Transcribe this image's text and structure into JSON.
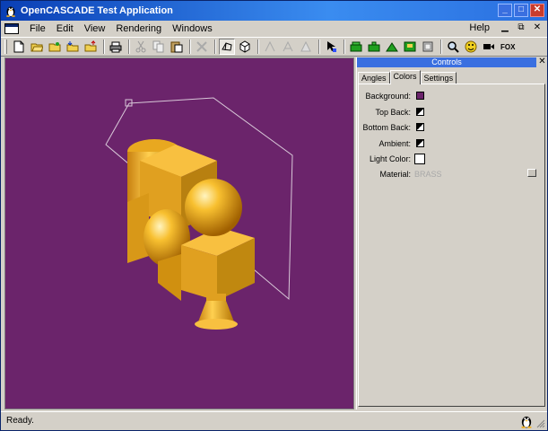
{
  "window": {
    "title": "OpenCASCADE Test Application",
    "buttons": {
      "minimize": "_",
      "maximize": "□",
      "close": "✕"
    }
  },
  "menu": {
    "items": [
      {
        "label": "File"
      },
      {
        "label": "Edit"
      },
      {
        "label": "View"
      },
      {
        "label": "Rendering"
      },
      {
        "label": "Windows"
      }
    ],
    "help": "Help",
    "mdi_restore": "⧉",
    "mdi_close": "✕"
  },
  "toolbar": {
    "icons": [
      "new-file-icon",
      "open-folder-icon",
      "open-folder-2-icon",
      "import-icon",
      "export-icon",
      "print-icon",
      "cut-icon",
      "copy-icon",
      "paste-icon",
      "delete-icon",
      "wireframe-icon",
      "shaded-icon",
      "fit-icon",
      "zoom-icon",
      "pan-icon",
      "select-icon",
      "color-icon",
      "material-icon",
      "transparency-icon",
      "texture-icon",
      "hidden-line-icon",
      "zoom-glass-icon",
      "rotate-icon",
      "camera-icon"
    ],
    "fox_label": "FOX"
  },
  "panel": {
    "title": "Controls",
    "close": "✕",
    "tabs": [
      {
        "label": "Angles"
      },
      {
        "label": "Colors"
      },
      {
        "label": "Settings"
      }
    ],
    "active_tab": "Colors",
    "rows": {
      "background": {
        "label": "Background:",
        "color": "#6b246b"
      },
      "top_back": {
        "label": "Top Back:"
      },
      "bottom_back": {
        "label": "Bottom Back:"
      },
      "ambient": {
        "label": "Ambient:"
      },
      "light_color": {
        "label": "Light Color:",
        "color": "#ffffff"
      },
      "material": {
        "label": "Material:",
        "value": "BRASS"
      }
    }
  },
  "viewport": {
    "background": "#6b246b",
    "model_color": "#f0b020"
  },
  "status": {
    "text": "Ready."
  }
}
